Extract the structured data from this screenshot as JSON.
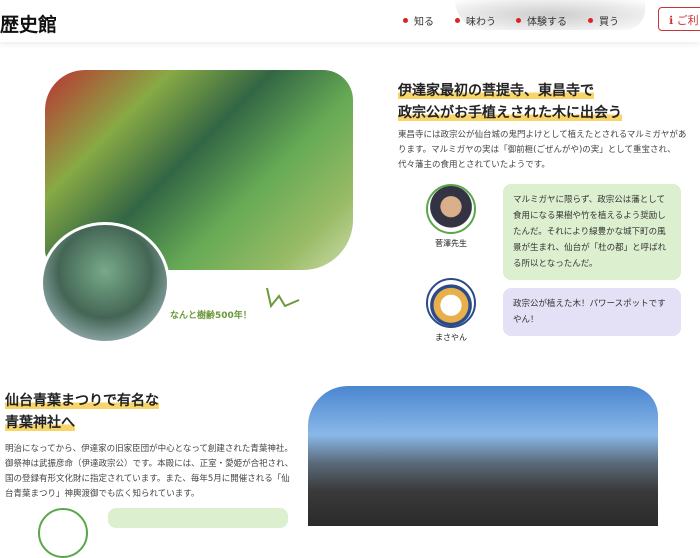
{
  "header": {
    "logo": "歴史館",
    "nav": [
      "知る",
      "味わう",
      "体験する",
      "買う"
    ],
    "button_label": "ご利"
  },
  "section1": {
    "title_line1": "伊達家最初の菩提寺、東昌寺で",
    "title_line2": "政宗公がお手植えされた木に出会う",
    "body": "東昌寺には政宗公が仙台城の鬼門よけとして植えたとされるマルミガヤがあります。マルミガヤの実は「御前榧(ごぜんがや)の実」として重宝され、代々藩主の食用とされていたようです。",
    "caption": "なんと樹齢500年！",
    "dialog": [
      {
        "name": "菅澤先生",
        "text": "マルミガヤに限らず、政宗公は藩として食用になる果樹や竹を植えるよう奨励したんだ。それにより緑豊かな城下町の風景が生まれ、仙台が「杜の都」と呼ばれる所以となったんだ。",
        "color": "#dcefcf"
      },
      {
        "name": "まさやん",
        "text": "政宗公が植えた木！パワースポットですやん！",
        "color": "#e4e0f5"
      }
    ]
  },
  "section2": {
    "title_line1": "仙台青葉まつりで有名な",
    "title_line2": "青葉神社へ",
    "body": "明治になってから、伊達家の旧家臣団が中心となって創建された青葉神社。御祭神は武振彦命（伊達政宗公）です。本殿には、正室・愛姫が合祀され、国の登録有形文化財に指定されています。また、毎年5月に開催される「仙台青葉まつり」神輿渡御でも広く知られています。"
  },
  "colors": {
    "accent": "#d22222",
    "highlight": "#f8d56b",
    "green": "#5aa74a"
  }
}
